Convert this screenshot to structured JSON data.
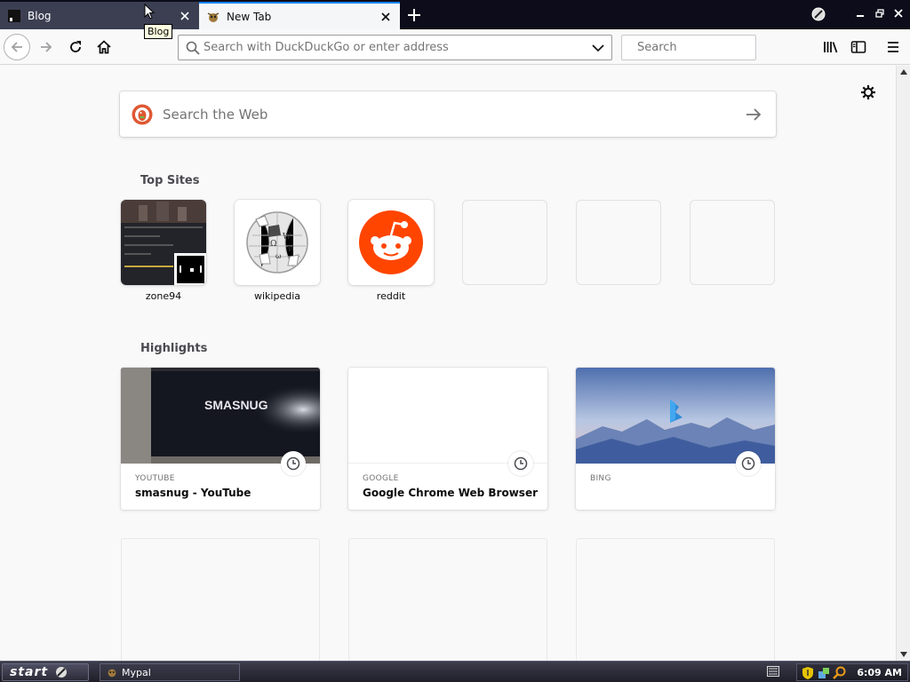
{
  "tabs": [
    {
      "title": "Blog",
      "active": false
    },
    {
      "title": "New Tab",
      "active": true
    }
  ],
  "tooltip": "Blog",
  "navbar": {
    "url_placeholder": "Search with DuckDuckGo or enter address",
    "search_placeholder": "Search"
  },
  "newtab": {
    "websearch_placeholder": "Search the Web",
    "top_sites_title": "Top Sites",
    "highlights_title": "Highlights",
    "top_sites": [
      {
        "label": "zone94"
      },
      {
        "label": "wikipedia"
      },
      {
        "label": "reddit"
      },
      {
        "label": ""
      },
      {
        "label": ""
      },
      {
        "label": ""
      }
    ],
    "highlights": [
      {
        "context": "YOUTUBE",
        "title": "smasnug - YouTube",
        "thumb_text": "SMASNUG"
      },
      {
        "context": "GOOGLE",
        "title": "Google Chrome Web Browser"
      },
      {
        "context": "BING",
        "title": ""
      }
    ]
  },
  "taskbar": {
    "start_label": "start",
    "task_item": "Mypal",
    "clock": "6:09 AM"
  },
  "colors": {
    "tab_highlight": "#0a84ff",
    "reddit": "#ff4500",
    "ddg": "#de5833"
  }
}
